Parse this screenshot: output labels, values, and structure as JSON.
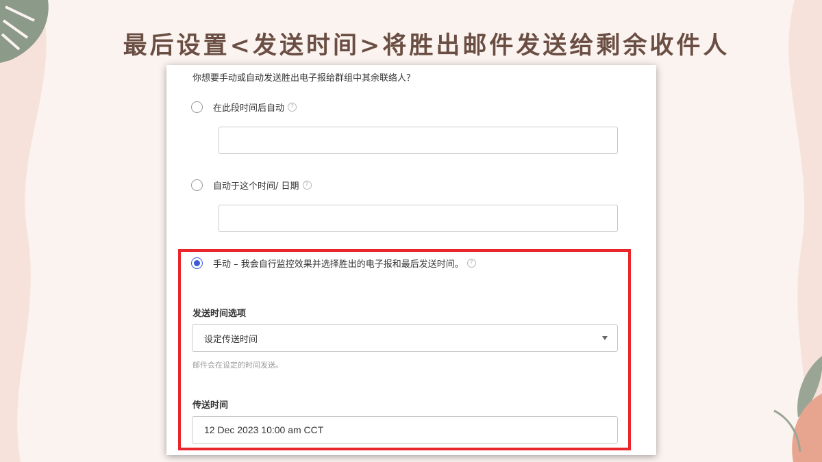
{
  "slide": {
    "title": "最后设置<发送时间>将胜出邮件发送给剩余收件人"
  },
  "form": {
    "question": "你想要手动或自动发送胜出电子报给群组中其余联络人？",
    "options": [
      {
        "label": "在此段时间后自动",
        "checked": false
      },
      {
        "label": "自动于这个时间/ 日期",
        "checked": false
      },
      {
        "label": "手动 – 我会自行监控效果并选择胜出的电子报和最后发送时间。",
        "checked": true
      }
    ],
    "help_glyph": "?",
    "send_option": {
      "label": "发送时间选项",
      "selected": "设定传送时间",
      "hint": "邮件会在设定的时间发送。"
    },
    "send_time": {
      "label": "传送时间",
      "value": "12 Dec 2023 10:00 am CCT"
    }
  },
  "colors": {
    "accent": "#3a5dd6",
    "highlight": "#e8262c",
    "title": "#6a4e43",
    "background": "#fbf3ef"
  }
}
